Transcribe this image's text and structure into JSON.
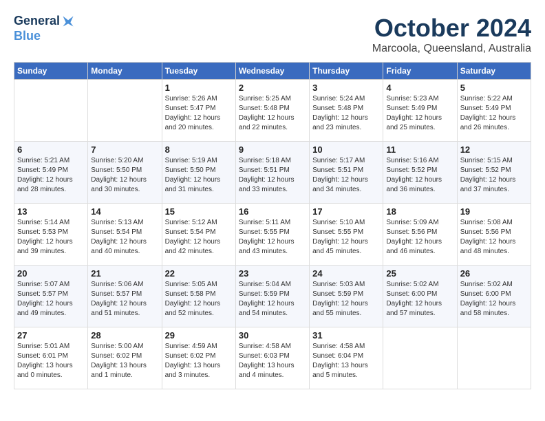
{
  "logo": {
    "line1": "General",
    "line2": "Blue"
  },
  "title": "October 2024",
  "subtitle": "Marcoola, Queensland, Australia",
  "days_of_week": [
    "Sunday",
    "Monday",
    "Tuesday",
    "Wednesday",
    "Thursday",
    "Friday",
    "Saturday"
  ],
  "weeks": [
    [
      {
        "day": "",
        "info": ""
      },
      {
        "day": "",
        "info": ""
      },
      {
        "day": "1",
        "info": "Sunrise: 5:26 AM\nSunset: 5:47 PM\nDaylight: 12 hours\nand 20 minutes."
      },
      {
        "day": "2",
        "info": "Sunrise: 5:25 AM\nSunset: 5:48 PM\nDaylight: 12 hours\nand 22 minutes."
      },
      {
        "day": "3",
        "info": "Sunrise: 5:24 AM\nSunset: 5:48 PM\nDaylight: 12 hours\nand 23 minutes."
      },
      {
        "day": "4",
        "info": "Sunrise: 5:23 AM\nSunset: 5:49 PM\nDaylight: 12 hours\nand 25 minutes."
      },
      {
        "day": "5",
        "info": "Sunrise: 5:22 AM\nSunset: 5:49 PM\nDaylight: 12 hours\nand 26 minutes."
      }
    ],
    [
      {
        "day": "6",
        "info": "Sunrise: 5:21 AM\nSunset: 5:49 PM\nDaylight: 12 hours\nand 28 minutes."
      },
      {
        "day": "7",
        "info": "Sunrise: 5:20 AM\nSunset: 5:50 PM\nDaylight: 12 hours\nand 30 minutes."
      },
      {
        "day": "8",
        "info": "Sunrise: 5:19 AM\nSunset: 5:50 PM\nDaylight: 12 hours\nand 31 minutes."
      },
      {
        "day": "9",
        "info": "Sunrise: 5:18 AM\nSunset: 5:51 PM\nDaylight: 12 hours\nand 33 minutes."
      },
      {
        "day": "10",
        "info": "Sunrise: 5:17 AM\nSunset: 5:51 PM\nDaylight: 12 hours\nand 34 minutes."
      },
      {
        "day": "11",
        "info": "Sunrise: 5:16 AM\nSunset: 5:52 PM\nDaylight: 12 hours\nand 36 minutes."
      },
      {
        "day": "12",
        "info": "Sunrise: 5:15 AM\nSunset: 5:52 PM\nDaylight: 12 hours\nand 37 minutes."
      }
    ],
    [
      {
        "day": "13",
        "info": "Sunrise: 5:14 AM\nSunset: 5:53 PM\nDaylight: 12 hours\nand 39 minutes."
      },
      {
        "day": "14",
        "info": "Sunrise: 5:13 AM\nSunset: 5:54 PM\nDaylight: 12 hours\nand 40 minutes."
      },
      {
        "day": "15",
        "info": "Sunrise: 5:12 AM\nSunset: 5:54 PM\nDaylight: 12 hours\nand 42 minutes."
      },
      {
        "day": "16",
        "info": "Sunrise: 5:11 AM\nSunset: 5:55 PM\nDaylight: 12 hours\nand 43 minutes."
      },
      {
        "day": "17",
        "info": "Sunrise: 5:10 AM\nSunset: 5:55 PM\nDaylight: 12 hours\nand 45 minutes."
      },
      {
        "day": "18",
        "info": "Sunrise: 5:09 AM\nSunset: 5:56 PM\nDaylight: 12 hours\nand 46 minutes."
      },
      {
        "day": "19",
        "info": "Sunrise: 5:08 AM\nSunset: 5:56 PM\nDaylight: 12 hours\nand 48 minutes."
      }
    ],
    [
      {
        "day": "20",
        "info": "Sunrise: 5:07 AM\nSunset: 5:57 PM\nDaylight: 12 hours\nand 49 minutes."
      },
      {
        "day": "21",
        "info": "Sunrise: 5:06 AM\nSunset: 5:57 PM\nDaylight: 12 hours\nand 51 minutes."
      },
      {
        "day": "22",
        "info": "Sunrise: 5:05 AM\nSunset: 5:58 PM\nDaylight: 12 hours\nand 52 minutes."
      },
      {
        "day": "23",
        "info": "Sunrise: 5:04 AM\nSunset: 5:59 PM\nDaylight: 12 hours\nand 54 minutes."
      },
      {
        "day": "24",
        "info": "Sunrise: 5:03 AM\nSunset: 5:59 PM\nDaylight: 12 hours\nand 55 minutes."
      },
      {
        "day": "25",
        "info": "Sunrise: 5:02 AM\nSunset: 6:00 PM\nDaylight: 12 hours\nand 57 minutes."
      },
      {
        "day": "26",
        "info": "Sunrise: 5:02 AM\nSunset: 6:00 PM\nDaylight: 12 hours\nand 58 minutes."
      }
    ],
    [
      {
        "day": "27",
        "info": "Sunrise: 5:01 AM\nSunset: 6:01 PM\nDaylight: 13 hours\nand 0 minutes."
      },
      {
        "day": "28",
        "info": "Sunrise: 5:00 AM\nSunset: 6:02 PM\nDaylight: 13 hours\nand 1 minute."
      },
      {
        "day": "29",
        "info": "Sunrise: 4:59 AM\nSunset: 6:02 PM\nDaylight: 13 hours\nand 3 minutes."
      },
      {
        "day": "30",
        "info": "Sunrise: 4:58 AM\nSunset: 6:03 PM\nDaylight: 13 hours\nand 4 minutes."
      },
      {
        "day": "31",
        "info": "Sunrise: 4:58 AM\nSunset: 6:04 PM\nDaylight: 13 hours\nand 5 minutes."
      },
      {
        "day": "",
        "info": ""
      },
      {
        "day": "",
        "info": ""
      }
    ]
  ]
}
